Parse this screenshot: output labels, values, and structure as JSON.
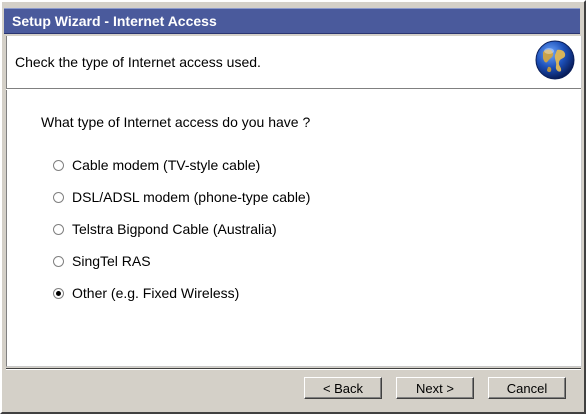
{
  "window": {
    "title": "Setup Wizard - Internet Access"
  },
  "header": {
    "subtitle": "Check the type of Internet access used.",
    "icon": "globe-icon"
  },
  "main": {
    "question": "What type of Internet access do you have ?",
    "selected": "Other (e.g. Fixed Wireless)",
    "options": [
      {
        "label": "Cable modem (TV-style cable)",
        "checked": false
      },
      {
        "label": "DSL/ADSL modem (phone-type cable)",
        "checked": false
      },
      {
        "label": "Telstra Bigpond Cable (Australia)",
        "checked": false
      },
      {
        "label": "SingTel RAS",
        "checked": false
      },
      {
        "label": "Other (e.g. Fixed Wireless)",
        "checked": true
      }
    ]
  },
  "buttons": {
    "back": "< Back",
    "next": "Next >",
    "cancel": "Cancel"
  },
  "colors": {
    "titlebar": "#4a5a9c",
    "chrome": "#d4d0c8",
    "panel": "#ffffff"
  }
}
